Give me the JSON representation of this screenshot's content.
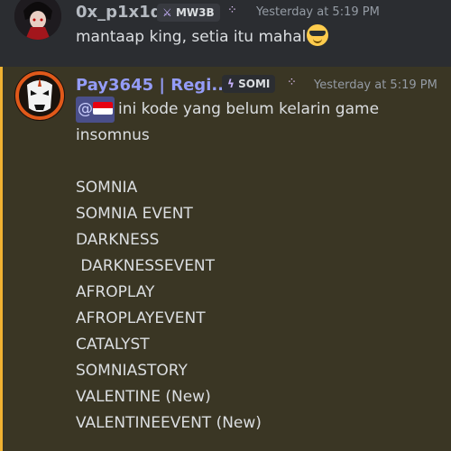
{
  "messages": [
    {
      "username": "0x_p1x1q",
      "tag_icon": "sword-icon",
      "tag_label": "MW3B",
      "decoration": "⁘",
      "timestamp": "Yesterday at 5:19 PM",
      "text": "mantaap king, setia itu mahal",
      "emoji": "sunglasses-emoji"
    },
    {
      "username": "Pay3645 | Regi...",
      "tag_icon": "lightning-icon",
      "tag_label": "SOMI",
      "decoration": "⁘",
      "timestamp": "Yesterday at 5:19 PM",
      "mention_symbol": "@",
      "mention_flag": "indonesia-flag-emoji",
      "intro_line1": "ini kode yang belum kelarin game",
      "intro_line2": "insomnus",
      "codes": [
        "SOMNIA",
        "SOMNIA EVENT",
        "DARKNESS",
        " DARKNESSEVENT",
        "AFROPLAY",
        "AFROPLAYEVENT",
        "CATALYST",
        "SOMNIASTORY",
        "VALENTINE (New)",
        "VALENTINEEVENT (New)"
      ]
    }
  ],
  "colors": {
    "background": "#2b2d31",
    "highlight_background": "#3a3624",
    "highlight_bar": "#f0b232",
    "username2": "#949cf7",
    "text": "#dbdee1",
    "timestamp": "#949ba4"
  }
}
